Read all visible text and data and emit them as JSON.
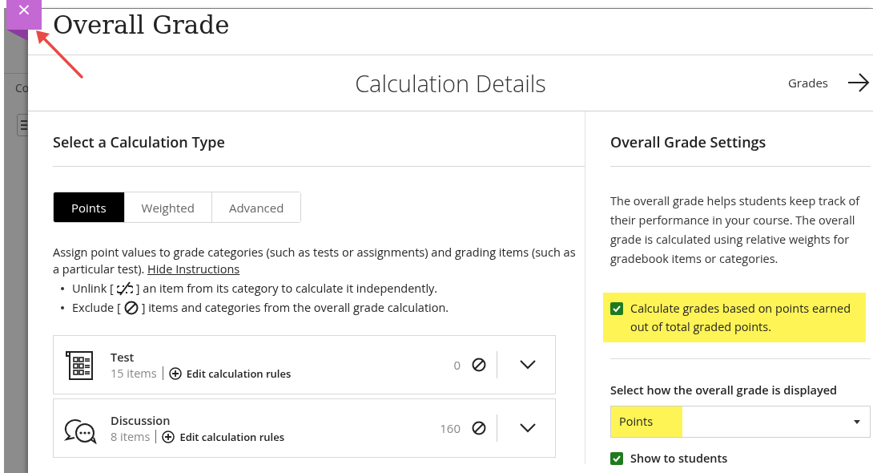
{
  "backdrop": {
    "label": "Co"
  },
  "panel": {
    "title": "Overall Grade",
    "close_label": "×"
  },
  "subheader": {
    "title": "Calculation Details",
    "nav_label": "Grades"
  },
  "calculation": {
    "heading": "Select a Calculation Type",
    "tabs": [
      {
        "label": "Points",
        "selected": true
      },
      {
        "label": "Weighted",
        "selected": false
      },
      {
        "label": "Advanced",
        "selected": false
      }
    ],
    "instructions": "Assign point values to grade categories (such as tests or assignments) and grading items (such as a particular test).",
    "instructions_link": "Hide Instructions",
    "bullets": [
      {
        "kind": "unlink",
        "before": "Unlink [",
        "after": "] an item from its category to calculate it independently."
      },
      {
        "kind": "exclude",
        "before": "Exclude [",
        "after": "] items and categories from the overall grade calculation."
      }
    ],
    "categories": [
      {
        "kind": "test",
        "name": "Test",
        "count": "15 items",
        "action": "Edit calculation rules",
        "points": "0"
      },
      {
        "kind": "discussion",
        "name": "Discussion",
        "count": "8 items",
        "action": "Edit calculation rules",
        "points": "160"
      }
    ]
  },
  "settings": {
    "heading": "Overall Grade Settings",
    "description": "The overall grade helps students keep track of their performance in your course. The overall grade is calculated using relative weights for gradebook items or categories.",
    "points_option": {
      "label": "Calculate grades based on points earned out of total graded points.",
      "checked": true,
      "highlighted": true
    },
    "display_label": "Select how the overall grade is displayed",
    "display_select": {
      "value": "Points",
      "highlighted": true
    },
    "show_to_students": {
      "label": "Show to students",
      "checked": true
    }
  }
}
